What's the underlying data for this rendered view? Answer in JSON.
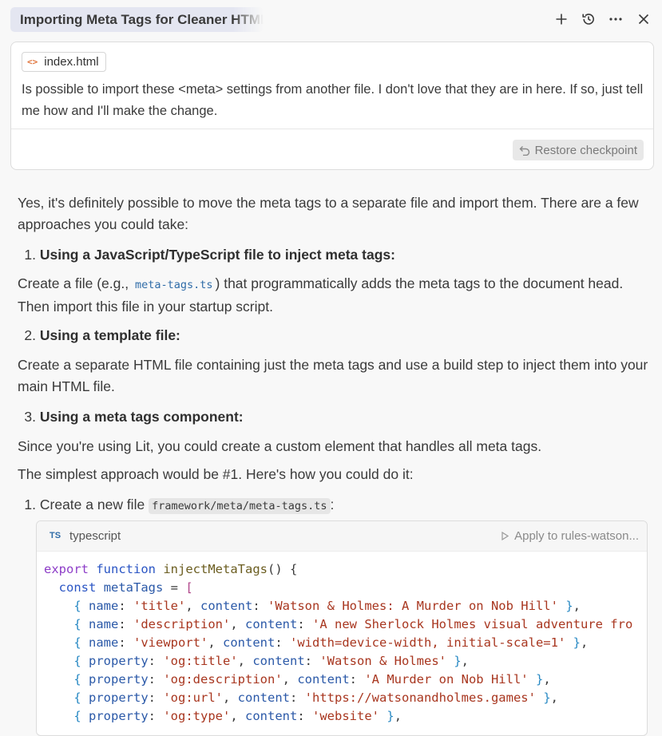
{
  "header": {
    "title": "Importing Meta Tags for Cleaner HTML",
    "icons": [
      "plus-icon",
      "history-icon",
      "more-icon",
      "close-icon"
    ]
  },
  "message": {
    "file_chip": "index.html",
    "text": "Is possible to import these <meta> settings from another file. I don't love that they are in here. If so, just tell me how and I'll make the change.",
    "restore_label": "Restore checkpoint"
  },
  "response": {
    "intro": "Yes, it's definitely possible to move the meta tags to a separate file and import them. There are a few approaches you could take:",
    "approaches": [
      {
        "num": "1.",
        "title": "Using a JavaScript/TypeScript file to inject meta tags:",
        "desc_before": "Create a file (e.g., ",
        "desc_code": "meta-tags.ts",
        "desc_after": ") that programmatically adds the meta tags to the document head. Then import this file in your startup script."
      },
      {
        "num": "2.",
        "title": "Using a template file:",
        "desc": "Create a separate HTML file containing just the meta tags and use a build step to inject them into your main HTML file."
      },
      {
        "num": "3.",
        "title": "Using a meta tags component:",
        "desc": "Since you're using Lit, you could create a custom element that handles all meta tags."
      }
    ],
    "simplest": "The simplest approach would be #1. Here's how you could do it:",
    "step1_num": "1.",
    "step1_before": "Create a new file ",
    "step1_code": "framework/meta/meta-tags.ts",
    "step1_after": ":"
  },
  "code_block": {
    "lang_badge": "TS",
    "language": "typescript",
    "apply_label": "Apply to rules-watson...",
    "lines": {
      "l1_kw": "export",
      "l1_kw2": "function",
      "l1_fn": "injectMetaTags",
      "l1_rest": "() {",
      "l2_kw": "const",
      "l2_var": "metaTags",
      "l2_rest": " = [",
      "rows": [
        {
          "key": "name",
          "k_val": "'title'",
          "c_val": "'Watson & Holmes: A Murder on Nob Hill'",
          "end": " },"
        },
        {
          "key": "name",
          "k_val": "'description'",
          "c_val": "'A new Sherlock Holmes visual adventure fro",
          "end": ""
        },
        {
          "key": "name",
          "k_val": "'viewport'",
          "c_val": "'width=device-width, initial-scale=1'",
          "end": " },"
        },
        {
          "key": "property",
          "k_val": "'og:title'",
          "c_val": "'Watson & Holmes'",
          "end": " },"
        },
        {
          "key": "property",
          "k_val": "'og:description'",
          "c_val": "'A Murder on Nob Hill'",
          "end": " },"
        },
        {
          "key": "property",
          "k_val": "'og:url'",
          "c_val": "'https://watsonandholmes.games'",
          "end": " },"
        },
        {
          "key": "property",
          "k_val": "'og:type'",
          "c_val": "'website'",
          "end": " },"
        }
      ],
      "content_key": "content"
    }
  }
}
